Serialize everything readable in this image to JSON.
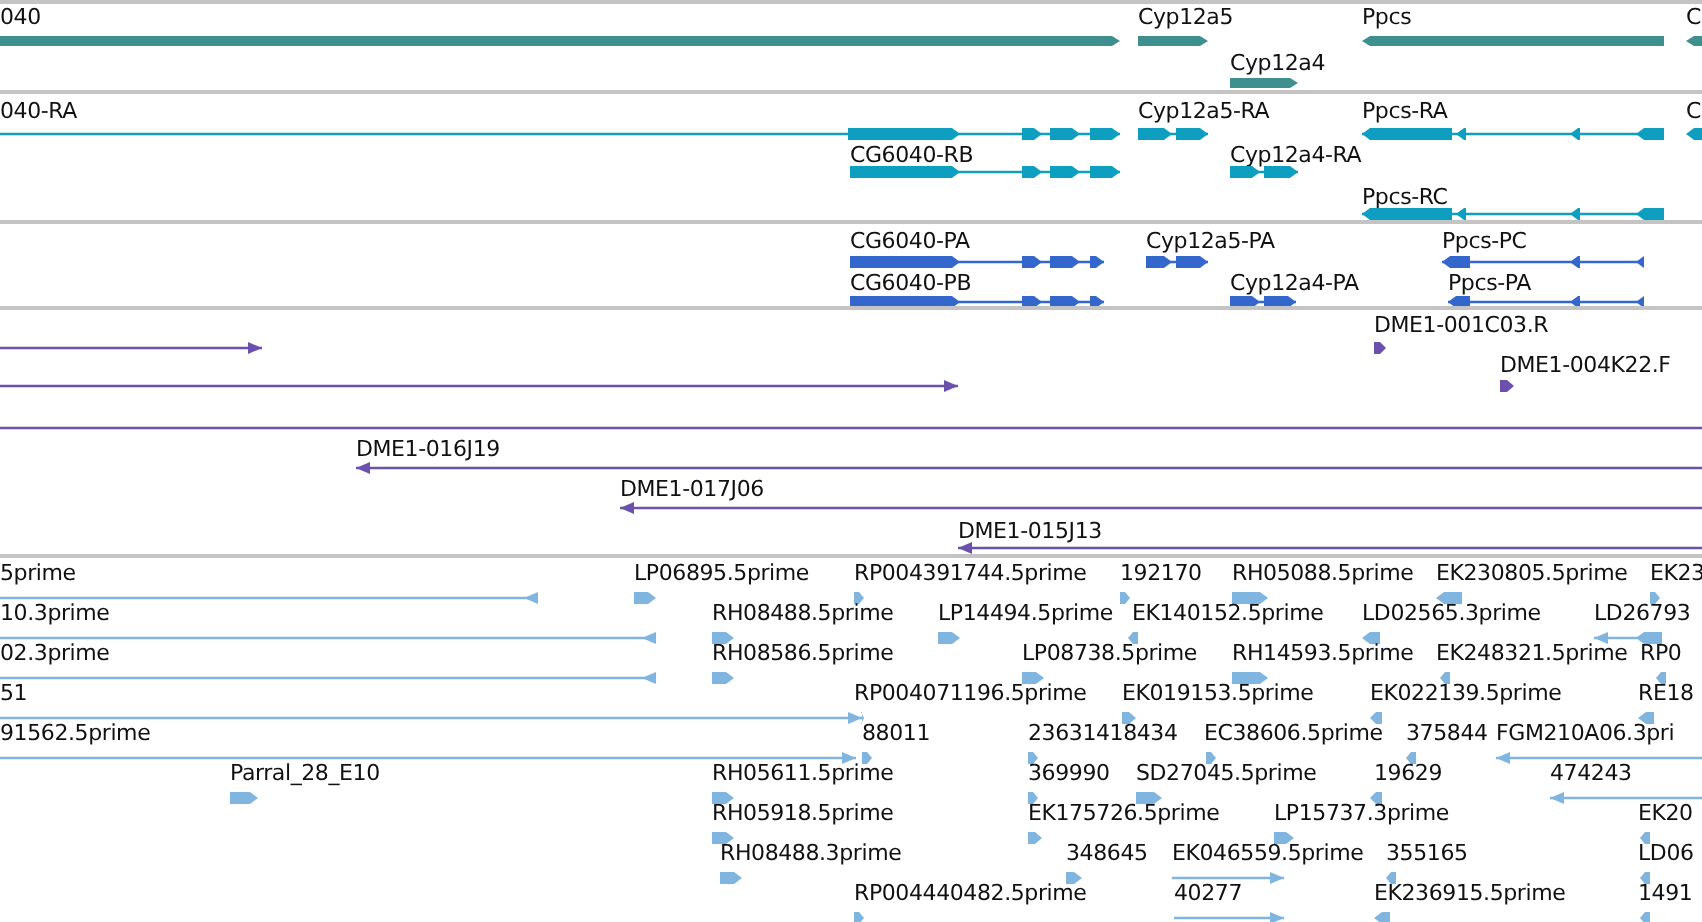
{
  "tracks": [
    {
      "kind": "gene",
      "color": "#3f8f8f",
      "features": [
        {
          "label": "040",
          "reverse": false
        },
        {
          "label": "Cyp12a5",
          "reverse": false
        },
        {
          "label": "Ppcs",
          "reverse": true
        },
        {
          "label": "C",
          "reverse": true
        },
        {
          "label": "Cyp12a4",
          "reverse": false
        }
      ]
    },
    {
      "kind": "transcript",
      "color": "#0e9fc0",
      "features": [
        {
          "label": "040-RA",
          "reverse": false
        },
        {
          "label": "Cyp12a5-RA",
          "reverse": false
        },
        {
          "label": "Ppcs-RA",
          "reverse": true
        },
        {
          "label": "C",
          "reverse": true
        },
        {
          "label": "CG6040-RB",
          "reverse": false
        },
        {
          "label": "Cyp12a4-RA",
          "reverse": false
        },
        {
          "label": "Ppcs-RC",
          "reverse": true
        }
      ]
    },
    {
      "kind": "protein",
      "color": "#3467cc",
      "features": [
        {
          "label": "CG6040-PA",
          "reverse": false
        },
        {
          "label": "Cyp12a5-PA",
          "reverse": false
        },
        {
          "label": "Ppcs-PC",
          "reverse": true
        },
        {
          "label": "CG6040-PB",
          "reverse": false
        },
        {
          "label": "Cyp12a4-PA",
          "reverse": false
        },
        {
          "label": "Ppcs-PA",
          "reverse": true
        }
      ]
    },
    {
      "kind": "clone",
      "color": "#6b50ad",
      "features": [
        {
          "reverse": false
        },
        {
          "label": "DME1-001C03.R",
          "reverse": false
        },
        {
          "reverse": false
        },
        {
          "label": "DME1-004K22.F",
          "reverse": false
        },
        {
          "reverse": false
        },
        {
          "label": "DME1-016J19",
          "reverse": true
        },
        {
          "label": "DME1-017J06",
          "reverse": true
        },
        {
          "label": "DME1-015J13",
          "reverse": true
        }
      ]
    },
    {
      "kind": "est",
      "color": "#7fb5de",
      "features": [
        {
          "label": "5prime",
          "reverse": true
        },
        {
          "label": "LP06895.5prime",
          "reverse": false
        },
        {
          "label": "RP004391744.5prime",
          "reverse": false
        },
        {
          "label": "192170",
          "reverse": false
        },
        {
          "label": "RH05088.5prime",
          "reverse": false
        },
        {
          "label": "EK230805.5prime",
          "reverse": true
        },
        {
          "label": "EK23",
          "reverse": false
        },
        {
          "label": "10.3prime",
          "reverse": true
        },
        {
          "label": "RH08488.5prime",
          "reverse": false
        },
        {
          "label": "LP14494.5prime",
          "reverse": false
        },
        {
          "label": "EK140152.5prime",
          "reverse": true
        },
        {
          "label": "LD02565.3prime",
          "reverse": true
        },
        {
          "label": "LD26793",
          "reverse": true
        },
        {
          "label": "02.3prime",
          "reverse": true
        },
        {
          "label": "RH08586.5prime",
          "reverse": false
        },
        {
          "label": "LP08738.5prime",
          "reverse": false
        },
        {
          "label": "RH14593.5prime",
          "reverse": false
        },
        {
          "label": "EK248321.5prime",
          "reverse": true
        },
        {
          "label": "RP0",
          "reverse": true
        },
        {
          "label": "51",
          "reverse": false
        },
        {
          "label": "RP004071196.5prime",
          "reverse": false
        },
        {
          "label": "EK019153.5prime",
          "reverse": false
        },
        {
          "label": "EK022139.5prime",
          "reverse": true
        },
        {
          "label": "RE18",
          "reverse": true
        },
        {
          "label": "91562.5prime",
          "reverse": false
        },
        {
          "label": "88011",
          "reverse": false
        },
        {
          "label": "23631418434",
          "reverse": false
        },
        {
          "label": "EC38606.5prime",
          "reverse": false
        },
        {
          "label": "375844",
          "reverse": true
        },
        {
          "label": "FGM210A06.3pri",
          "reverse": true
        },
        {
          "label": "Parral_28_E10",
          "reverse": false
        },
        {
          "label": "RH05611.5prime",
          "reverse": false
        },
        {
          "label": "369990",
          "reverse": false
        },
        {
          "label": "SD27045.5prime",
          "reverse": false
        },
        {
          "label": "19629",
          "reverse": true
        },
        {
          "label": "474243",
          "reverse": true
        },
        {
          "label": "RH05918.5prime",
          "reverse": false
        },
        {
          "label": "EK175726.5prime",
          "reverse": false
        },
        {
          "label": "LP15737.3prime",
          "reverse": false
        },
        {
          "label": "EK20",
          "reverse": true
        },
        {
          "label": "RH08488.3prime",
          "reverse": false
        },
        {
          "label": "348645",
          "reverse": false
        },
        {
          "label": "EK046559.5prime",
          "reverse": false
        },
        {
          "label": "355165",
          "reverse": true
        },
        {
          "label": "LD06",
          "reverse": true
        },
        {
          "label": "RP004440482.5prime",
          "reverse": false
        },
        {
          "label": "40277",
          "reverse": false
        },
        {
          "label": "EK236915.5prime",
          "reverse": true
        },
        {
          "label": "1491",
          "reverse": true
        }
      ]
    }
  ]
}
